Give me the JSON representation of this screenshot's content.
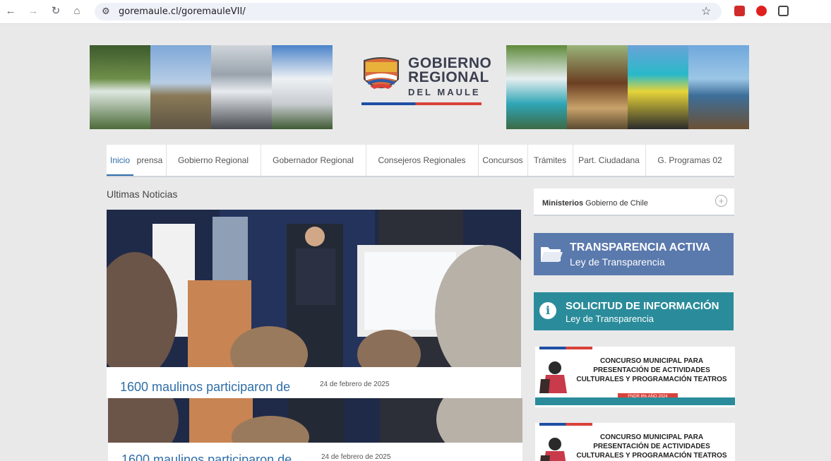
{
  "browser": {
    "url": "goremaule.cl/goremauleVII/"
  },
  "logo": {
    "line1": "GOBIERNO",
    "line2": "REGIONAL",
    "line3": "DEL MAULE"
  },
  "menu": {
    "items": [
      "Inicio",
      "prensa",
      "Gobierno Regional",
      "Gobernador Regional",
      "Consejeros Regionales",
      "Concursos",
      "Trámites",
      "Part. Ciudadana",
      "G. Programas 02"
    ],
    "active": "Inicio"
  },
  "news": {
    "section_title": "Ultimas Noticias",
    "items": [
      {
        "title": "1600 maulinos participaron de",
        "date": "24 de febrero de 2025"
      },
      {
        "title": "1600 maulinos participaron de",
        "date": "24 de febrero de 2025"
      }
    ]
  },
  "sidebar": {
    "ministerios_bold": "Ministerios",
    "ministerios_rest": "Gobierno de Chile",
    "transparencia_title": "TRANSPARENCIA ACTIVA",
    "transparencia_sub": "Ley de Transparencia",
    "solicitud_title": "SOLICITUD DE INFORMACIÓN",
    "solicitud_sub": "Ley de Transparencia",
    "concurso_line1": "CONCURSO  MUNICIPAL PARA",
    "concurso_line2": "PRESENTACIÓN DE ACTIVIDADES",
    "concurso_line3": "CULTURALES Y PROGRAMACIÓN TEATROS",
    "concurso_badge": "FNDR 8% AÑO 2024"
  },
  "colors": {
    "accent": "#2f6ea8",
    "transparencia_bg": "#5a79ad",
    "solicitud_bg": "#2a8c9a",
    "flag_blue": "#1e4fa5",
    "flag_red": "#d9423a"
  }
}
